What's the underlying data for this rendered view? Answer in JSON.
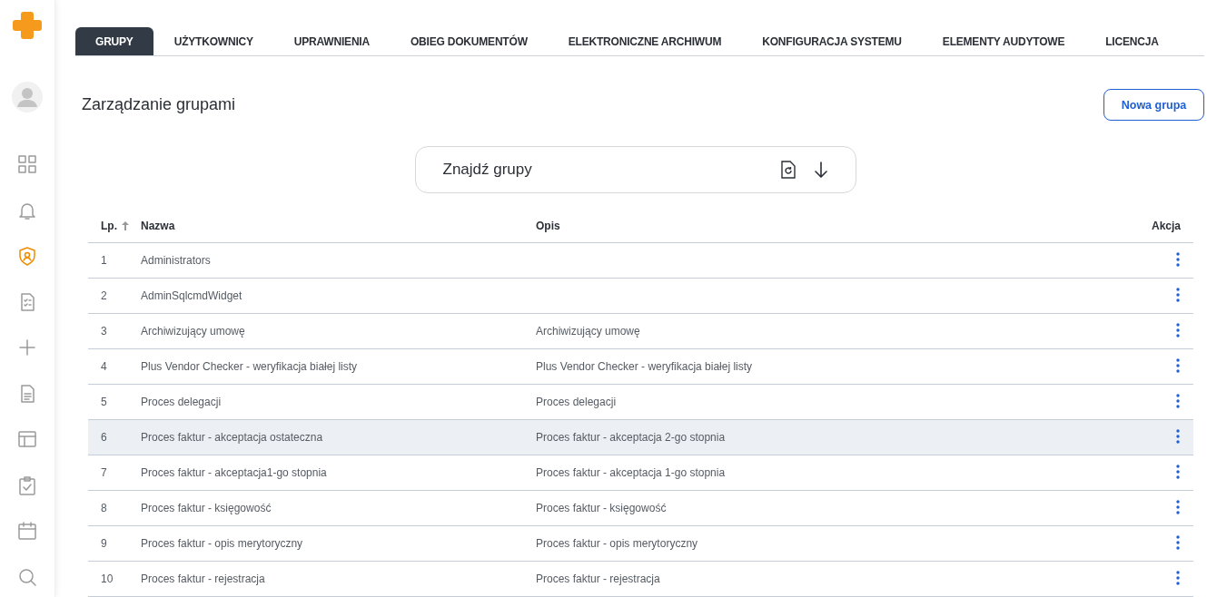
{
  "sidebar": {
    "items": [
      {
        "kind": "grid",
        "selected": false
      },
      {
        "kind": "bell",
        "selected": false
      },
      {
        "kind": "shield",
        "selected": true
      },
      {
        "kind": "checklist",
        "selected": false
      },
      {
        "kind": "plus",
        "selected": false
      },
      {
        "kind": "document",
        "selected": false
      },
      {
        "kind": "layout",
        "selected": false
      },
      {
        "kind": "clipboard",
        "selected": false
      },
      {
        "kind": "calendar",
        "selected": false
      },
      {
        "kind": "search",
        "selected": false
      }
    ]
  },
  "tabs": [
    {
      "label": "GRUPY",
      "selected": true
    },
    {
      "label": "UŻYTKOWNICY",
      "selected": false
    },
    {
      "label": "UPRAWNIENIA",
      "selected": false
    },
    {
      "label": "OBIEG DOKUMENTÓW",
      "selected": false
    },
    {
      "label": "ELEKTRONICZNE ARCHIWUM",
      "selected": false
    },
    {
      "label": "KONFIGURACJA SYSTEMU",
      "selected": false
    },
    {
      "label": "ELEMENTY AUDYTOWE",
      "selected": false
    },
    {
      "label": "LICENCJA",
      "selected": false
    }
  ],
  "page_title": "Zarządzanie grupami",
  "new_button": "Nowa grupa",
  "search": {
    "placeholder": "Znajdź grupy"
  },
  "table": {
    "columns": [
      "Lp.",
      "Nazwa",
      "Opis",
      "Akcja"
    ],
    "rows": [
      {
        "lp": "1",
        "name": "Administrators",
        "description": "",
        "selected": false
      },
      {
        "lp": "2",
        "name": "AdminSqlcmdWidget",
        "description": "",
        "selected": false
      },
      {
        "lp": "3",
        "name": "Archiwizujący umowę",
        "description": "Archiwizujący umowę",
        "selected": false
      },
      {
        "lp": "4",
        "name": "Plus Vendor Checker - weryfikacja białej listy",
        "description": "Plus Vendor Checker - weryfikacja białej listy",
        "selected": false
      },
      {
        "lp": "5",
        "name": "Proces delegacji",
        "description": "Proces delegacji",
        "selected": false
      },
      {
        "lp": "6",
        "name": "Proces faktur - akceptacja ostateczna",
        "description": "Proces faktur - akceptacja 2-go stopnia",
        "selected": true
      },
      {
        "lp": "7",
        "name": "Proces faktur - akceptacja1-go stopnia",
        "description": "Proces faktur - akceptacja 1-go stopnia",
        "selected": false
      },
      {
        "lp": "8",
        "name": "Proces faktur - księgowość",
        "description": "Proces faktur - księgowość",
        "selected": false
      },
      {
        "lp": "9",
        "name": "Proces faktur - opis merytoryczny",
        "description": "Proces faktur - opis merytoryczny",
        "selected": false
      },
      {
        "lp": "10",
        "name": "Proces faktur - rejestracja",
        "description": "Proces faktur - rejestracja",
        "selected": false
      }
    ]
  }
}
